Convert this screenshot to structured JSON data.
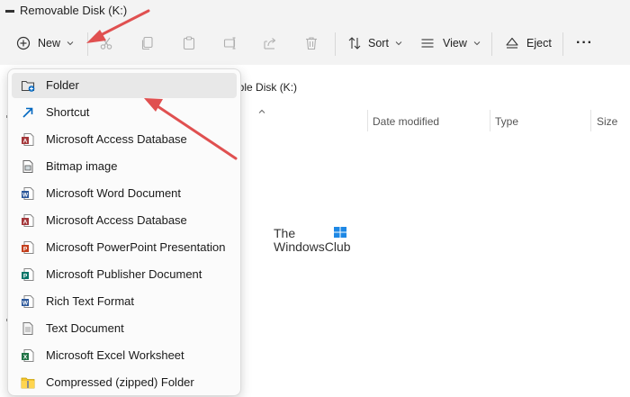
{
  "window": {
    "title": "Removable Disk (K:)"
  },
  "toolbar": {
    "new_label": "New",
    "sort_label": "Sort",
    "view_label": "View",
    "eject_label": "Eject",
    "more_label": "···"
  },
  "address": {
    "path_text": "able Disk (K:)"
  },
  "columns": {
    "date_modified": "Date modified",
    "type": "Type",
    "size": "Size"
  },
  "watermark": {
    "line1": "The",
    "line2": "WindowsClub"
  },
  "new_menu": {
    "items": [
      {
        "label": "Folder",
        "icon": "folder-new-icon"
      },
      {
        "label": "Shortcut",
        "icon": "shortcut-icon"
      },
      {
        "label": "Microsoft Access Database",
        "icon": "access-icon"
      },
      {
        "label": "Bitmap image",
        "icon": "bitmap-icon"
      },
      {
        "label": "Microsoft Word Document",
        "icon": "word-icon"
      },
      {
        "label": "Microsoft Access Database",
        "icon": "access-icon"
      },
      {
        "label": "Microsoft PowerPoint Presentation",
        "icon": "powerpoint-icon"
      },
      {
        "label": "Microsoft Publisher Document",
        "icon": "publisher-icon"
      },
      {
        "label": "Rich Text Format",
        "icon": "rtf-icon"
      },
      {
        "label": "Text Document",
        "icon": "text-document-icon"
      },
      {
        "label": "Microsoft Excel Worksheet",
        "icon": "excel-icon"
      },
      {
        "label": "Compressed (zipped) Folder",
        "icon": "zip-folder-icon"
      }
    ]
  },
  "colors": {
    "annotation_arrow": "#e05050",
    "accent": "#0067c0"
  }
}
